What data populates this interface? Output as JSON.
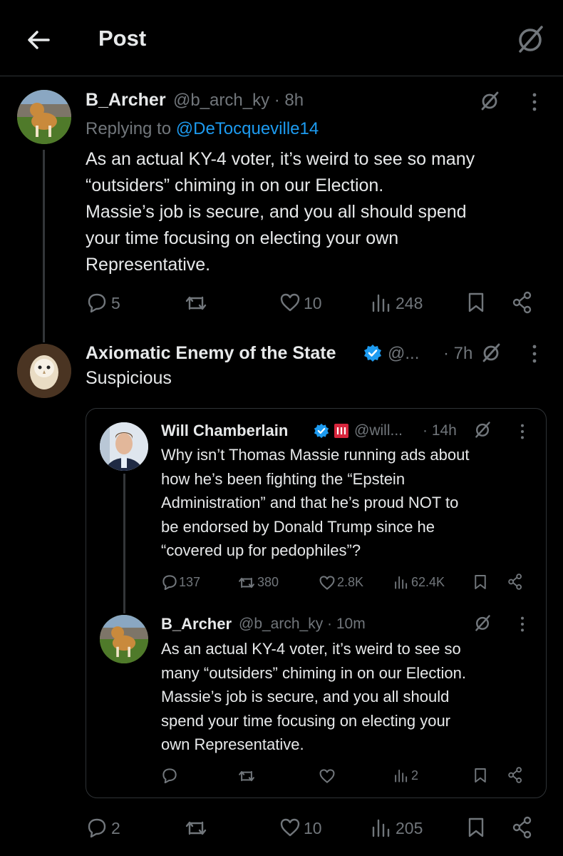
{
  "header": {
    "title": "Post"
  },
  "post1": {
    "name": "B_Archer",
    "handle_time": "@b_arch_ky · 8h",
    "replying_prefix": "Replying to",
    "replying_to": "@DeTocqueville14",
    "text": "As an actual KY-4  voter, it’s weird to see so many\n“outsiders” chiming in on our Election.\nMassie’s job is secure, and you all should spend\nyour time focusing on electing your own\nRepresentative.",
    "replies": "5",
    "likes": "10",
    "views": "248"
  },
  "post2": {
    "name": "Axiomatic Enemy of the State",
    "handle": "@...",
    "time": "· 7h",
    "text": "Suspicious",
    "replies": "2",
    "likes": "10",
    "views": "205"
  },
  "quote1": {
    "name": "Will Chamberlain",
    "handle": "@will...",
    "time": "· 14h",
    "text": "Why isn’t Thomas Massie running ads about\nhow he’s been fighting the “Epstein\nAdministration” and that he’s proud NOT to\nbe endorsed by Donald Trump since he\n“covered up for pedophiles”?",
    "replies": "137",
    "reposts": "380",
    "likes": "2.8K",
    "views": "62.4K"
  },
  "quote2": {
    "name": "B_Archer",
    "handle_time": "@b_arch_ky · 10m",
    "text": "As an actual KY-4  voter, it’s weird to see so\nmany “outsiders” chiming in on our Election.\nMassie’s job is secure, and you all should\nspend your time focusing on electing your\nown Representative.",
    "views": "2"
  },
  "colors": {
    "background": "#000000",
    "text": "#e7e9ea",
    "muted": "#71767b",
    "accent": "#1d9bf0",
    "divider": "#2f3336"
  }
}
